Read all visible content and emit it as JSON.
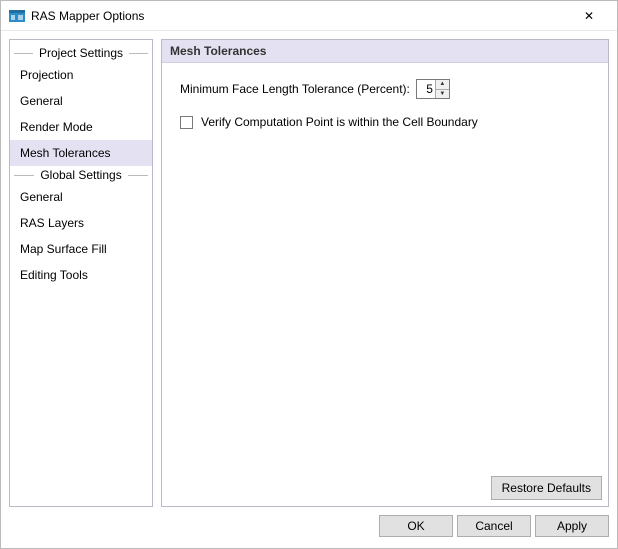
{
  "window": {
    "title": "RAS Mapper Options",
    "close_symbol": "✕"
  },
  "sidebar": {
    "section1_label": "Project Settings",
    "section2_label": "Global Settings",
    "project_items": [
      {
        "label": "Projection"
      },
      {
        "label": "General"
      },
      {
        "label": "Render Mode"
      },
      {
        "label": "Mesh Tolerances",
        "selected": true
      }
    ],
    "global_items": [
      {
        "label": "General"
      },
      {
        "label": "RAS Layers"
      },
      {
        "label": "Map Surface Fill"
      },
      {
        "label": "Editing Tools"
      }
    ]
  },
  "panel": {
    "header": "Mesh Tolerances",
    "min_face_label": "Minimum Face Length Tolerance (Percent):",
    "min_face_value": "5",
    "spinner_up": "▲",
    "spinner_down": "▼",
    "verify_label": "Verify Computation Point is within the Cell Boundary",
    "verify_checked": false,
    "restore_label": "Restore Defaults"
  },
  "footer": {
    "ok": "OK",
    "cancel": "Cancel",
    "apply": "Apply"
  }
}
